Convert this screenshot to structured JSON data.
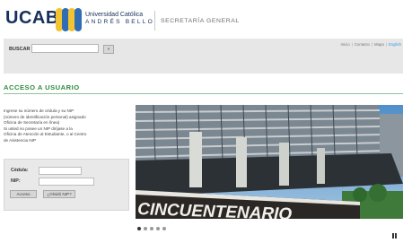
{
  "header": {
    "logo_text": "UCAB",
    "university_line1": "Universidad Católica",
    "university_line2": "ANDRÉS BELLO",
    "department": "SECRETARÍA GENERAL",
    "logo_colors": [
      "#f4c430",
      "#2f6db5",
      "#f4c430",
      "#2f6db5"
    ]
  },
  "search": {
    "label": "BUSCAR",
    "placeholder": "",
    "button_label": "»"
  },
  "top_links": {
    "items": [
      "Inicio",
      "Contacto",
      "Mapa",
      "English"
    ]
  },
  "section": {
    "title": "ACCESO A USUARIO",
    "intro_lines": [
      "Ingrese su número de cédula y su NIP",
      "(número de identificación personal) asignado",
      "Oficina de Secretaría en línea)",
      "Si usted no posee un NIP diríjase a la",
      "Oficina de Atención al Estudiante, o al Centro",
      "de Asistencia NIP"
    ]
  },
  "login": {
    "cedula_label": "Cédula:",
    "nip_label": "NIP:",
    "cedula_value": "",
    "nip_value": "",
    "enter_label": "Acceso",
    "forgot_label": "¿Olvidó NIP?"
  },
  "slider": {
    "caption": "CINCUENTENARIO",
    "slide_count": 5,
    "active_index": 0
  },
  "colors": {
    "brand_blue": "#16305b",
    "accent_green": "#2e8b3d",
    "panel_gray": "#e7e7e7"
  }
}
